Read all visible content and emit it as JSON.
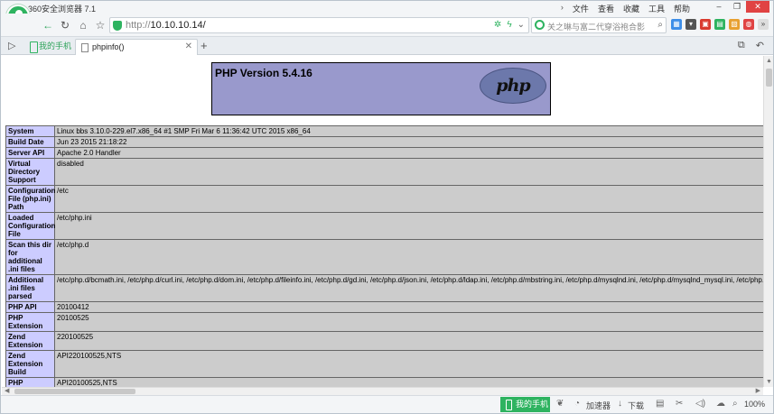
{
  "window": {
    "title": "360安全浏览器 7.1",
    "menu": [
      "文件",
      "查看",
      "收藏",
      "工具",
      "帮助"
    ],
    "controls": {
      "minimize": "–",
      "restore": "❐",
      "close": "✕"
    }
  },
  "navbar": {
    "url_prefix": "http://",
    "url_host": "10.10.10.14/",
    "search_placeholder": "关之琳与富二代穿浴袍合影",
    "icons": [
      "back-arrow-icon",
      "forward-arrow-icon",
      "home-icon",
      "star-icon",
      "shield-icon",
      "search-icon"
    ]
  },
  "tabs": {
    "phone_tab": "我的手机",
    "active_tab": "phpinfo()"
  },
  "phpinfo": {
    "version": "PHP Version 5.4.16",
    "logo_text": "php",
    "rows": [
      {
        "key": "System",
        "value": "Linux bbs 3.10.0-229.el7.x86_64 #1 SMP Fri Mar 6 11:36:42 UTC 2015 x86_64"
      },
      {
        "key": "Build Date",
        "value": "Jun 23 2015 21:18:22"
      },
      {
        "key": "Server API",
        "value": "Apache 2.0 Handler"
      },
      {
        "key": "Virtual Directory Support",
        "value": "disabled"
      },
      {
        "key": "Configuration File (php.ini) Path",
        "value": "/etc"
      },
      {
        "key": "Loaded Configuration File",
        "value": "/etc/php.ini"
      },
      {
        "key": "Scan this dir for additional .ini files",
        "value": "/etc/php.d"
      },
      {
        "key": "Additional .ini files parsed",
        "value": "/etc/php.d/bcmath.ini, /etc/php.d/curl.ini, /etc/php.d/dom.ini, /etc/php.d/fileinfo.ini, /etc/php.d/gd.ini, /etc/php.d/json.ini, /etc/php.d/ldap.ini, /etc/php.d/mbstring.ini, /etc/php.d/mysqlnd.ini, /etc/php.d/mysqlnd_mysql.ini, /etc/php.d/mysqlnd_my"
      },
      {
        "key": "PHP API",
        "value": "20100412"
      },
      {
        "key": "PHP Extension",
        "value": "20100525"
      },
      {
        "key": "Zend Extension",
        "value": "220100525"
      },
      {
        "key": "Zend Extension Build",
        "value": "API220100525,NTS"
      },
      {
        "key": "PHP Extension Build",
        "value": "API20100525,NTS"
      }
    ]
  },
  "statusbar": {
    "phone": "我的手机",
    "accelerator": "加速器",
    "download": "下载",
    "zoom": "100%"
  },
  "colors": {
    "brand_green": "#2eb360",
    "php_header": "#9999cc",
    "php_key": "#ccccff",
    "php_value": "#cccccc"
  }
}
